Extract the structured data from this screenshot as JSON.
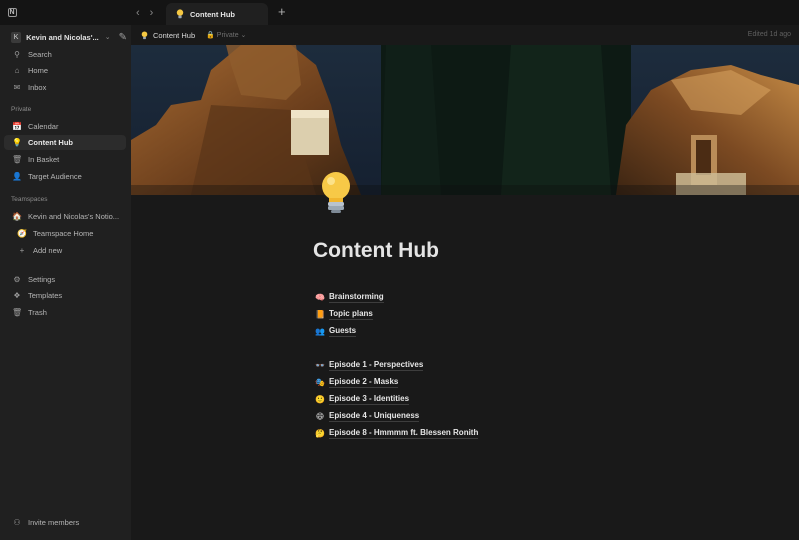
{
  "titlebar": {
    "logo": "N",
    "tab_title": "Content Hub",
    "tab_icon": "bulb-icon",
    "new_tab_label": "+"
  },
  "sidebar": {
    "workspace": {
      "badge": "K",
      "name": "Kevin and Nicolas'..."
    },
    "top_items": [
      {
        "label": "Search",
        "icon": "search-icon",
        "glyph": "⚲"
      },
      {
        "label": "Home",
        "icon": "home-icon",
        "glyph": "⌂"
      },
      {
        "label": "Inbox",
        "icon": "inbox-icon",
        "glyph": "✉"
      }
    ],
    "private_label": "Private",
    "private_items": [
      {
        "label": "Calendar",
        "icon": "calendar-icon",
        "glyph": "📅"
      },
      {
        "label": "Content Hub",
        "icon": "bulb-icon",
        "glyph": "💡",
        "active": true
      },
      {
        "label": "In Basket",
        "icon": "basket-icon",
        "glyph": "🗑"
      },
      {
        "label": "Target Audience",
        "icon": "person-icon",
        "glyph": "👤"
      }
    ],
    "teamspaces_label": "Teamspaces",
    "team_items": [
      {
        "label": "Kevin and Nicolas's Notio...",
        "icon": "house-icon",
        "glyph": "🏠"
      },
      {
        "label": "Teamspace Home",
        "icon": "compass-icon",
        "glyph": "🧭"
      },
      {
        "label": "Add new",
        "icon": "plus-icon",
        "glyph": "+"
      }
    ],
    "bottom_items": [
      {
        "label": "Settings",
        "icon": "gear-icon",
        "glyph": "⚙"
      },
      {
        "label": "Templates",
        "icon": "templates-icon",
        "glyph": "❖"
      },
      {
        "label": "Trash",
        "icon": "trash-icon",
        "glyph": "🗑"
      }
    ],
    "invite_label": "Invite members"
  },
  "header": {
    "breadcrumb": "Content Hub",
    "privacy": "Private",
    "edited": "Edited 1d ago"
  },
  "page": {
    "title": "Content Hub",
    "links": [
      {
        "label": "Brainstorming",
        "emoji": "🧠"
      },
      {
        "label": "Topic plans",
        "emoji": "📙"
      },
      {
        "label": "Guests",
        "emoji": "👥"
      }
    ],
    "episodes": [
      {
        "label": "Episode 1 - Perspectives",
        "emoji": "👓"
      },
      {
        "label": "Episode 2 - Masks",
        "emoji": "🎭"
      },
      {
        "label": "Episode 3 - Identities",
        "emoji": "🙂"
      },
      {
        "label": "Episode 4 - Uniqueness",
        "emoji": "😄"
      },
      {
        "label": "Episode 8 - Hmmmm ft. Blessen Ronith",
        "emoji": "🤔"
      }
    ]
  },
  "colors": {
    "background": "#191919",
    "sidebar": "#202020",
    "titlebar": "#141414",
    "active_item": "#2c2c2c"
  }
}
